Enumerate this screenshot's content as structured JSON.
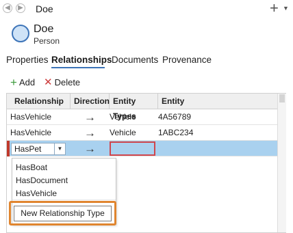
{
  "topbar": {
    "title": "Doe"
  },
  "entity": {
    "name": "Doe",
    "type": "Person"
  },
  "tabs": [
    {
      "label": "Properties"
    },
    {
      "label": "Relationships"
    },
    {
      "label": "Documents"
    },
    {
      "label": "Provenance"
    }
  ],
  "toolbar": {
    "add_label": "Add",
    "delete_label": "Delete"
  },
  "grid": {
    "columns": [
      "Relationship",
      "Direction",
      "Entity Types",
      "Entity"
    ],
    "rows": [
      {
        "relationship": "HasVehicle",
        "direction": "→",
        "entity_type": "Vehicle",
        "entity": "4A56789"
      },
      {
        "relationship": "HasVehicle",
        "direction": "→",
        "entity_type": "Vehicle",
        "entity": "1ABC234"
      }
    ],
    "edit_row": {
      "relationship": "HasPet",
      "direction": "→"
    }
  },
  "dropdown": {
    "options": [
      "HasBoat",
      "HasDocument",
      "HasVehicle"
    ],
    "new_type_label": "New Relationship Type"
  },
  "colors": {
    "accent": "#3d74b8",
    "selected_row": "#a9d1ef",
    "highlight": "#e0852f",
    "error": "#d0454c"
  }
}
